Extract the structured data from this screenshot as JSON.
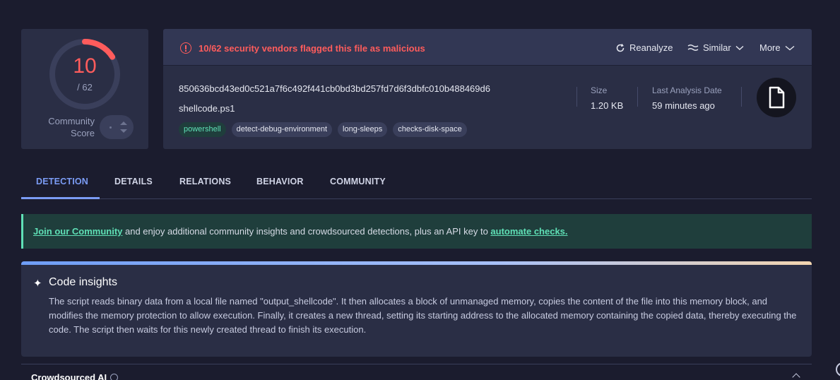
{
  "score": {
    "detections": "10",
    "total": "/ 62",
    "detections_value": 10,
    "total_value": 62,
    "community_label": "Community\nScore"
  },
  "alert": {
    "text": "10/62 security vendors flagged this file as malicious",
    "color": "#ff5c5c"
  },
  "header_actions": {
    "reanalyze": "Reanalyze",
    "similar": "Similar",
    "more": "More"
  },
  "file": {
    "hash": "850636bcd43ed0c521a7f6c492f441cb0bd3bd257fd7d6f3dbfc010b488469d6",
    "name": "shellcode.ps1",
    "tags": [
      "powershell",
      "detect-debug-environment",
      "long-sleeps",
      "checks-disk-space"
    ],
    "size_label": "Size",
    "size_value": "1.20 KB",
    "analysis_label": "Last Analysis Date",
    "analysis_value": "59 minutes ago",
    "icon": "file-icon"
  },
  "tabs": [
    "DETECTION",
    "DETAILS",
    "RELATIONS",
    "BEHAVIOR",
    "COMMUNITY"
  ],
  "active_tab": "DETECTION",
  "banner": {
    "link1": "Join our Community",
    "middle": " and enjoy additional community insights and crowdsourced detections, plus an API key to ",
    "link2": "automate checks."
  },
  "insights": {
    "title": "Code insights",
    "body": "The script reads binary data from a local file named \"output_shellcode\". It then allocates a block of unmanaged memory, copies the content of the file into this memory block, and modifies the memory protection to allow execution. Finally, it creates a new thread, setting its starting address to the allocated memory containing the copied data, thereby executing the code. The script then waits for this newly created thread to finish its execution."
  },
  "crowdsourced": {
    "title": "Crowdsourced AI"
  },
  "colors": {
    "malicious": "#ff5c5c",
    "accent": "#7b9cf5",
    "community_green": "#5fe0b6"
  }
}
